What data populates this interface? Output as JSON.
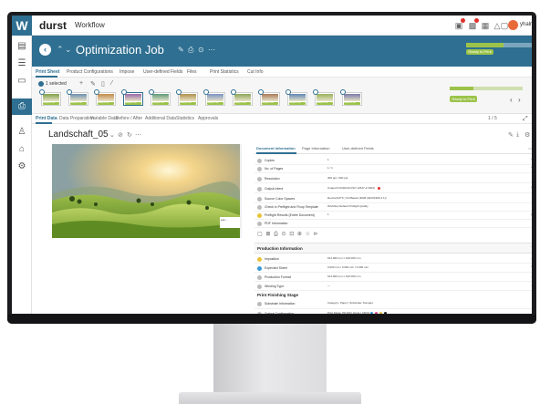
{
  "app": {
    "logo_letter": "W",
    "brand": "durst",
    "brand_sub": "Workflow",
    "username": "yhalma"
  },
  "job": {
    "title": "Optimization Job",
    "progress_fraction": 0.45,
    "status_pill": "Ready to Print"
  },
  "main_tabs": [
    "Print Sheet",
    "Product Configurations",
    "Impose",
    "User-defined Fields",
    "Files",
    "Print Statistics",
    "Cut Info"
  ],
  "strip": {
    "selected_text": "1 selected",
    "thumb_tag": "Ready to Print",
    "thumb_count": 12,
    "selected_thumb_index": 3,
    "right_pill": "Ready to Print",
    "right_progress_fraction": 0.33
  },
  "sub_tabs": [
    "Print Data",
    "Data Preparation",
    "Variable Data",
    "Before / After",
    "Additional Data",
    "Statistics",
    "Approvals"
  ],
  "pager": "1 / 5",
  "document": {
    "title": "Landschaft_05",
    "image_label": "Lan..."
  },
  "info_tabs": [
    "Document Information",
    "Page Information",
    "User-defined Fields"
  ],
  "rows": [
    {
      "label": "Copies",
      "value": "1"
    },
    {
      "label": "No. of Pages",
      "value": "1 / 1"
    },
    {
      "label": "Resolution",
      "value": "300 ppi  /  300 ppi"
    },
    {
      "label": "Output Intent",
      "value": "Coated FOGRA39 (ISO 12647-2:2004)"
    },
    {
      "label": "Source Color Spaces",
      "value": "DeviceCMYK | ICCBased (RGB (IEC61966-2.1))"
    },
    {
      "label": "Check in Preflight and Fixup Template",
      "value": "Workflow Default Preflight Quality"
    },
    {
      "label": "Preflight Results (Entire Document)",
      "value": "1"
    },
    {
      "label": "PDF Information",
      "value": ""
    }
  ],
  "production": {
    "section_title": "Production Information",
    "rows": [
      {
        "label": "Imposition",
        "value": "914.000 mm x 610.000 mm"
      },
      {
        "label": "Expected Sheet",
        "value": "0.000 mm  /  0.000 mm  /  0.000 mm"
      },
      {
        "label": "Production Format",
        "value": "914.000 mm x 610.000 mm"
      },
      {
        "label": "Winding Type",
        "value": "—"
      }
    ]
  },
  "print_stage": {
    "section_title": "Print Finishing Stage",
    "rows": [
      {
        "label": "Substrate Information",
        "value": "Category: Paper  |  Substrate: Sumajet"
      },
      {
        "label": "Output Configuration",
        "value": "Print Mode: P8 300  |  Durst  |  CMYK"
      }
    ]
  },
  "colors": {
    "accent": "#2f6f91",
    "ok_green": "#9bc34a",
    "alert_red": "#e0302c"
  }
}
